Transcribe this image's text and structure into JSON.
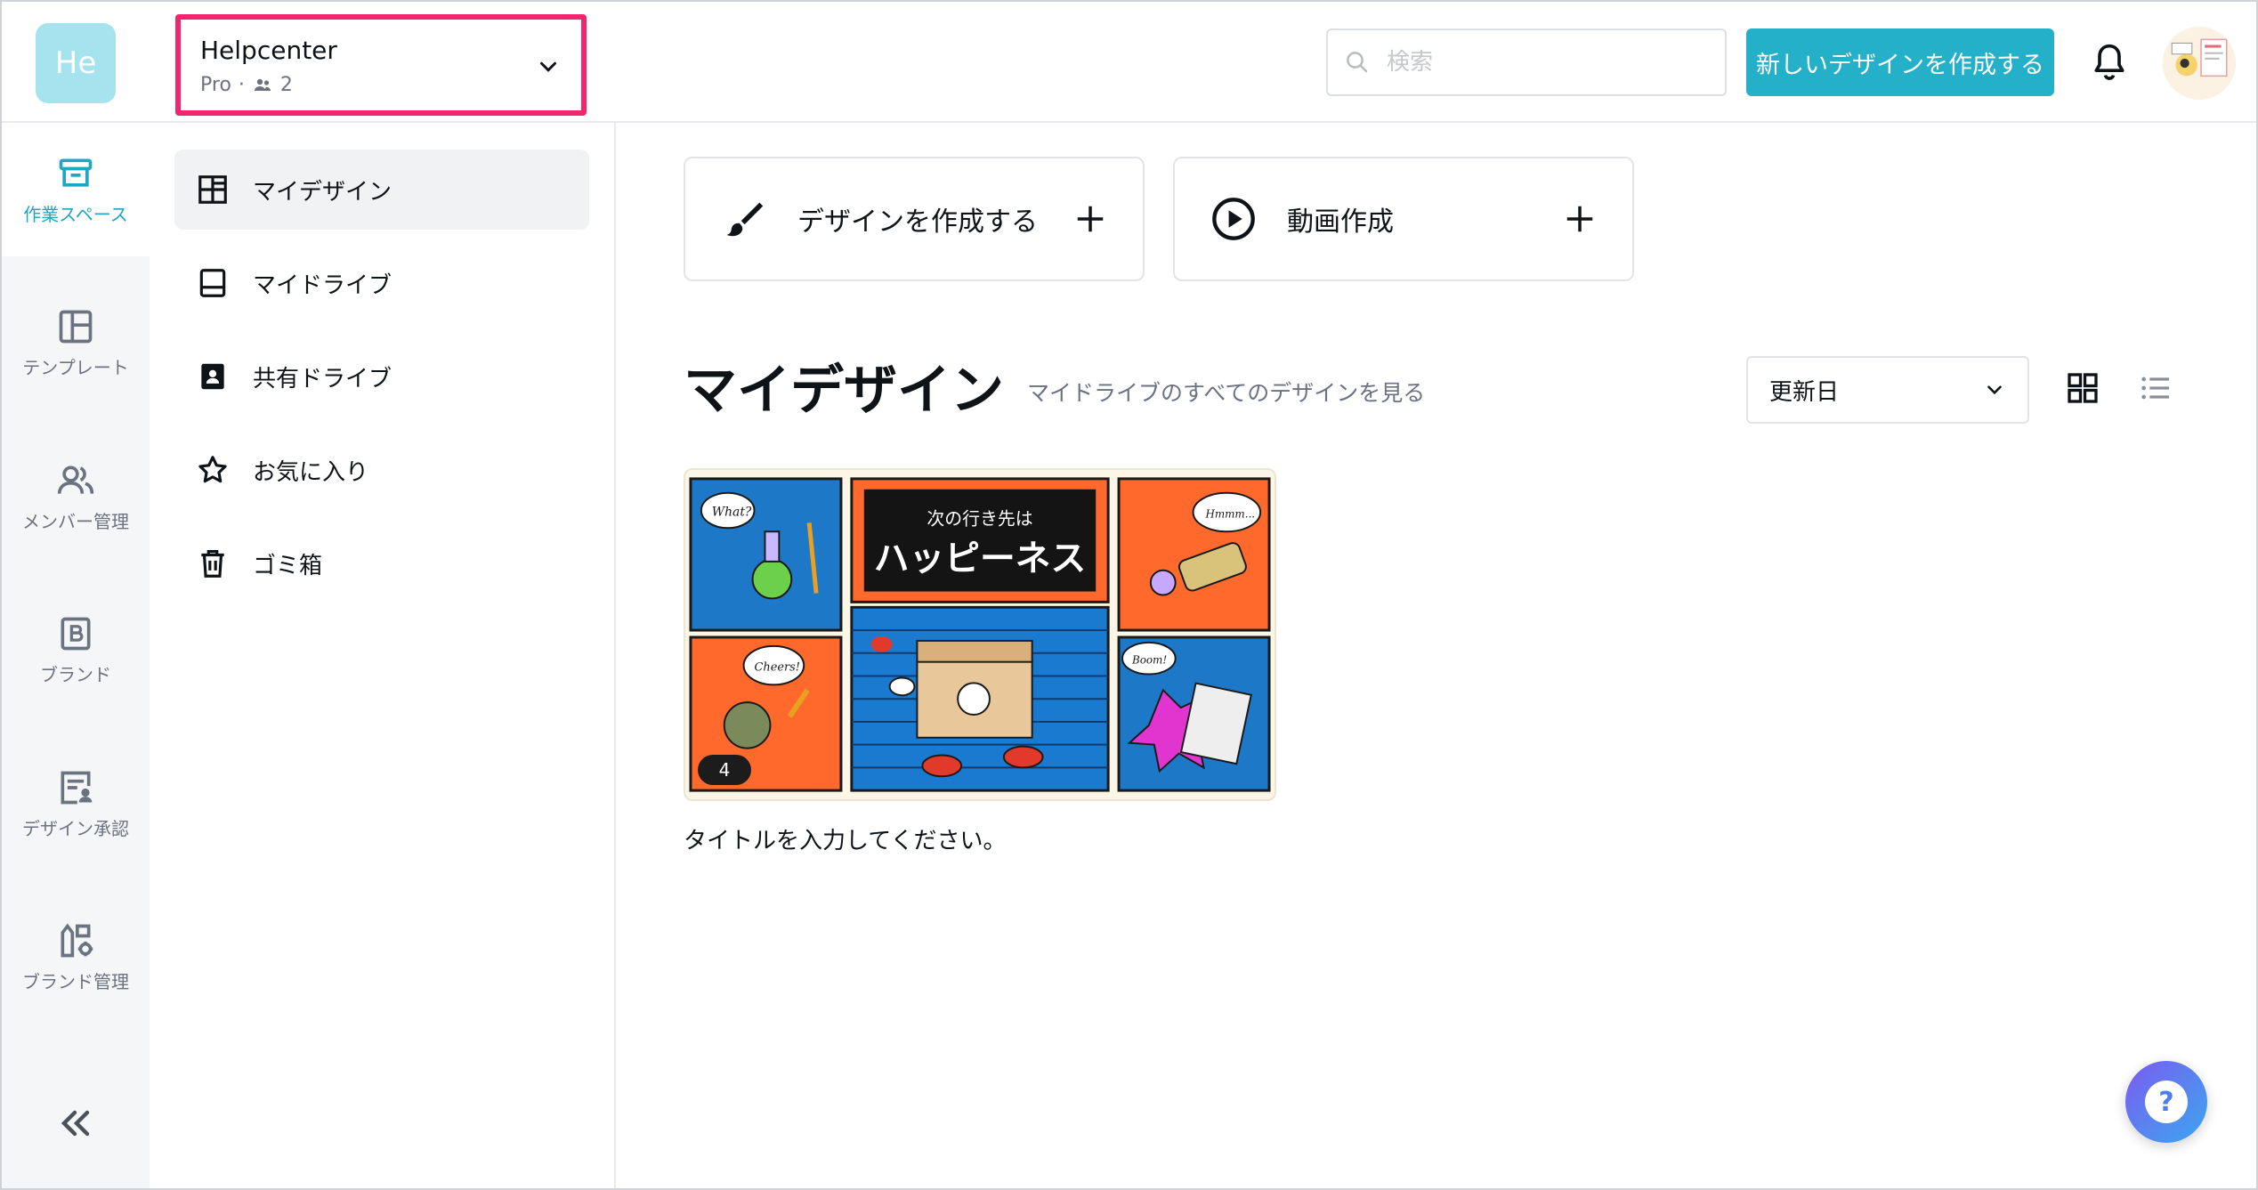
{
  "header": {
    "logo_text": "He",
    "team": {
      "name": "Helpcenter",
      "plan": "Pro",
      "separator": "·",
      "member_count": "2"
    },
    "search": {
      "placeholder": "検索"
    },
    "create_button": "新しいデザインを作成する"
  },
  "rail": {
    "items": [
      {
        "label": "作業スペース",
        "icon": "archive-icon",
        "active": true
      },
      {
        "label": "テンプレート",
        "icon": "template-icon"
      },
      {
        "label": "メンバー管理",
        "icon": "people-icon"
      },
      {
        "label": "ブランド",
        "icon": "brand-icon"
      },
      {
        "label": "デザイン承認",
        "icon": "approval-icon"
      },
      {
        "label": "ブランド管理",
        "icon": "brand-manage-icon"
      }
    ],
    "collapse_label": "«"
  },
  "sidebar": {
    "items": [
      {
        "label": "マイデザイン",
        "icon": "grid-layout-icon",
        "active": true
      },
      {
        "label": "マイドライブ",
        "icon": "drive-icon"
      },
      {
        "label": "共有ドライブ",
        "icon": "shared-drive-icon"
      },
      {
        "label": "お気に入り",
        "icon": "star-icon"
      },
      {
        "label": "ゴミ箱",
        "icon": "trash-icon"
      }
    ]
  },
  "main": {
    "quick_actions": [
      {
        "label": "デザインを作成する",
        "icon": "brush-icon"
      },
      {
        "label": "動画作成",
        "icon": "play-circle-icon"
      }
    ],
    "section_title": "マイデザイン",
    "section_subtitle": "マイドライブのすべてのデザインを見る",
    "sort": {
      "selected": "更新日"
    },
    "designs": [
      {
        "title": "タイトルを入力してください。",
        "page_count": "4",
        "thumbnail_text": {
          "line1": "次の行き先は",
          "line2": "ハッピーネス",
          "bubble1": "What?",
          "bubble2": "Hmmm...",
          "bubble3": "Cheers!",
          "bubble4": "Boom!"
        }
      }
    ]
  },
  "help": {
    "label": "?"
  },
  "colors": {
    "accent": "#23b0c8",
    "highlight": "#f0266f",
    "rail_bg": "#f5f6f8"
  }
}
